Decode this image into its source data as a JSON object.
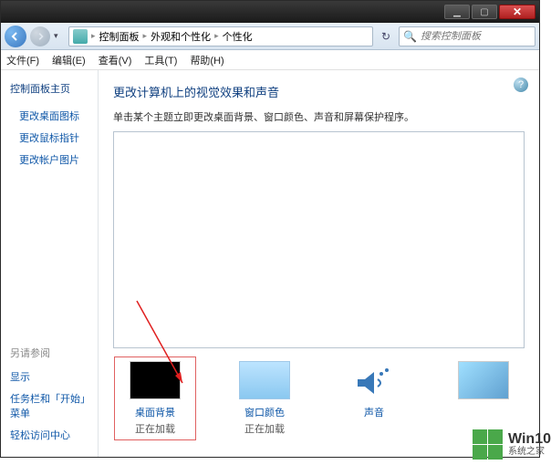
{
  "titlebar": {
    "min": "▁",
    "max": "▢",
    "close": "✕"
  },
  "nav": {
    "breadcrumb": [
      "控制面板",
      "外观和个性化",
      "个性化"
    ],
    "search_placeholder": "搜索控制面板"
  },
  "menu": {
    "file": "文件(F)",
    "edit": "编辑(E)",
    "view": "查看(V)",
    "tools": "工具(T)",
    "help": "帮助(H)"
  },
  "sidebar": {
    "home": "控制面板主页",
    "links": [
      "更改桌面图标",
      "更改鼠标指针",
      "更改帐户图片"
    ],
    "see_also": "另请参阅",
    "see_links": [
      "显示",
      "任务栏和「开始」菜单",
      "轻松访问中心"
    ]
  },
  "content": {
    "title": "更改计算机上的视觉效果和声音",
    "subtitle": "单击某个主题立即更改桌面背景、窗口颜色、声音和屏幕保护程序。"
  },
  "items": [
    {
      "label": "桌面背景",
      "status": "正在加载"
    },
    {
      "label": "窗口颜色",
      "status": "正在加载"
    },
    {
      "label": "声音",
      "status": ""
    },
    {
      "label": "",
      "status": ""
    }
  ],
  "watermark": {
    "brand": "Win10",
    "site": "系统之家"
  }
}
